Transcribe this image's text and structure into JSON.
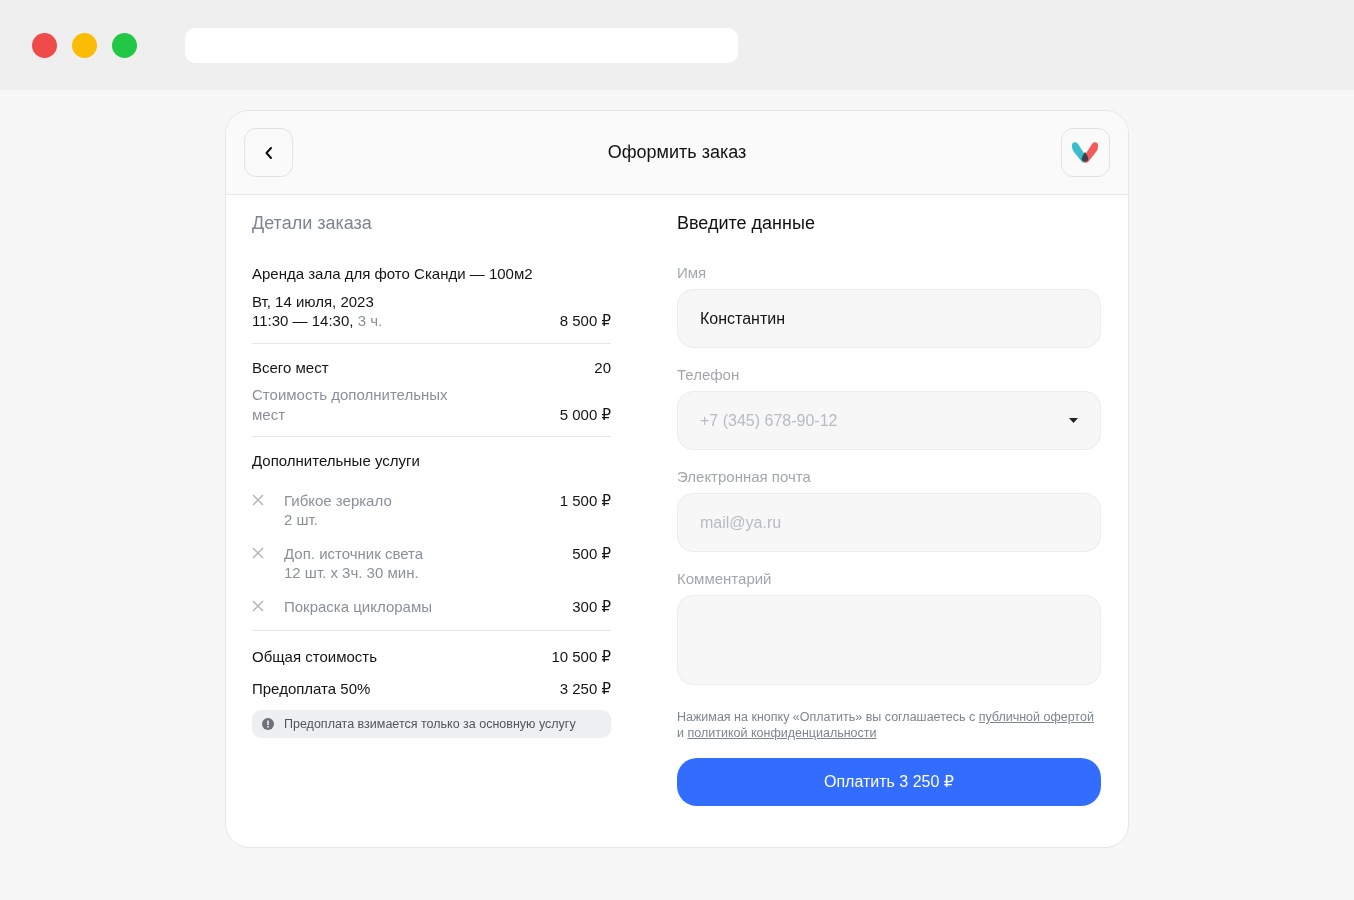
{
  "browser": {
    "traffic_lights": [
      {
        "color": "#f04b4b"
      },
      {
        "color": "#fbbc05"
      },
      {
        "color": "#22c744"
      }
    ]
  },
  "header": {
    "title": "Оформить заказ"
  },
  "order": {
    "title": "Детали заказа",
    "service": {
      "name": "Аренда зала для фото Сканди — 100м2",
      "date": "Вт, 14 июля, 2023",
      "time": "11:30 — 14:30,",
      "duration": "3 ч.",
      "price": "8 500 ₽"
    },
    "seats": {
      "label": "Всего мест",
      "value": "20"
    },
    "extra_seats": {
      "label": "Стоимость дополнительных мест",
      "value": "5 000 ₽"
    },
    "services_title": "Дополнительные услуги",
    "services": [
      {
        "name": "Гибкое зеркало",
        "detail": "2 шт.",
        "price": "1 500 ₽"
      },
      {
        "name": "Доп. источник света",
        "detail": "12 шт. х  3ч. 30 мин.",
        "price": "500 ₽"
      },
      {
        "name": "Покраска циклорамы",
        "price": "300 ₽"
      }
    ],
    "total": {
      "label": "Общая стоимость",
      "value": "10 500 ₽"
    },
    "prepay": {
      "label": "Предоплата 50%",
      "value": "3 250 ₽"
    },
    "note": "Предоплата взимается только за основную услугу"
  },
  "form": {
    "title": "Введите данные",
    "fields": [
      {
        "kind": "input",
        "label": "Имя",
        "value": "Константин"
      },
      {
        "kind": "select",
        "label": "Телефон",
        "placeholder": "+7 (345) 678-90-12"
      },
      {
        "kind": "input",
        "label": "Электронная почта",
        "placeholder": "mail@ya.ru"
      },
      {
        "kind": "textarea",
        "label": "Комментарий"
      }
    ],
    "consent": [
      {
        "kind": "text",
        "text": "Нажимая на кнопку «Оплатить» вы соглашаетесь с "
      },
      {
        "kind": "link",
        "text": "публичной офертой"
      },
      {
        "kind": "text",
        "text": " и "
      },
      {
        "kind": "link",
        "text": "политикой конфиденциальности"
      }
    ],
    "pay_button": "Оплатить 3 250 ₽"
  }
}
